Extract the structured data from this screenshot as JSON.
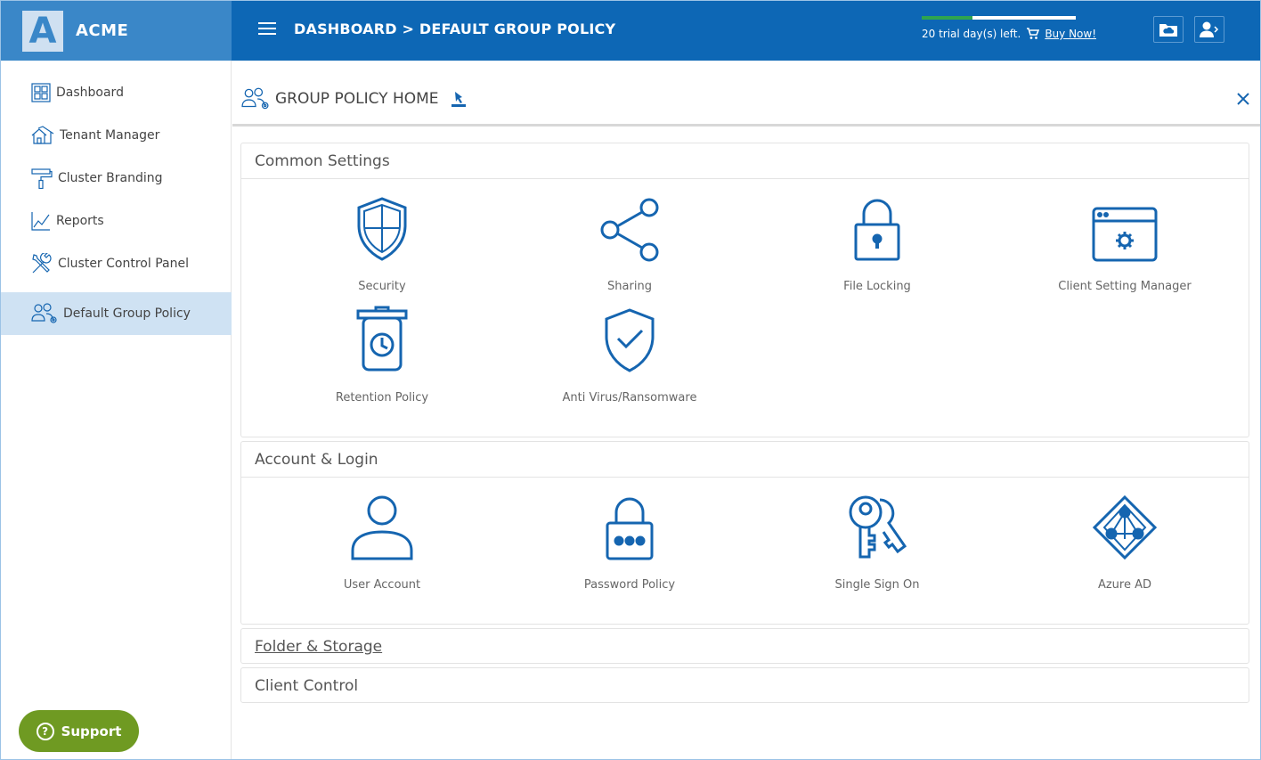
{
  "brand": {
    "logo_letter": "A",
    "name": "ACME"
  },
  "header": {
    "breadcrumb": "DASHBOARD > DEFAULT GROUP POLICY",
    "trial_text": "20 trial day(s) left.",
    "buy_now": "Buy Now!",
    "trial_progress": 0.33
  },
  "sidebar": {
    "items": [
      {
        "label": "Dashboard"
      },
      {
        "label": "Tenant Manager"
      },
      {
        "label": "Cluster Branding"
      },
      {
        "label": "Reports"
      },
      {
        "label": "Cluster Control Panel"
      },
      {
        "label": "Default Group Policy"
      }
    ],
    "support": "Support"
  },
  "page": {
    "title": "GROUP POLICY HOME"
  },
  "sections": {
    "common": {
      "title": "Common Settings",
      "tiles": [
        "Security",
        "Sharing",
        "File Locking",
        "Client Setting Manager",
        "Retention Policy",
        "Anti Virus/Ransomware"
      ]
    },
    "account": {
      "title": "Account & Login",
      "tiles": [
        "User Account",
        "Password Policy",
        "Single Sign On",
        "Azure AD"
      ]
    },
    "folder": {
      "title": "Folder & Storage"
    },
    "client": {
      "title": "Client Control"
    }
  },
  "colors": {
    "primary": "#0d67b5",
    "brand": "#3a87c8",
    "icon": "#1565b0",
    "support": "#6f9a22",
    "active": "#cfe2f3"
  }
}
